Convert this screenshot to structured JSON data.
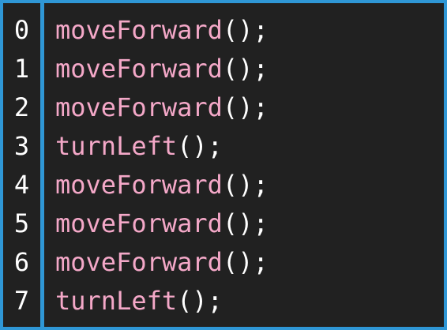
{
  "colors": {
    "frame": "#2f97d6",
    "background": "#212121",
    "function_name": "#f4a8c8",
    "punctuation": "#ffffff",
    "line_number": "#ffffff"
  },
  "code": {
    "lines": [
      {
        "number": "0",
        "function": "moveForward",
        "suffix": "();"
      },
      {
        "number": "1",
        "function": "moveForward",
        "suffix": "();"
      },
      {
        "number": "2",
        "function": "moveForward",
        "suffix": "();"
      },
      {
        "number": "3",
        "function": "turnLeft",
        "suffix": "();"
      },
      {
        "number": "4",
        "function": "moveForward",
        "suffix": "();"
      },
      {
        "number": "5",
        "function": "moveForward",
        "suffix": "();"
      },
      {
        "number": "6",
        "function": "moveForward",
        "suffix": "();"
      },
      {
        "number": "7",
        "function": "turnLeft",
        "suffix": "();"
      }
    ]
  }
}
